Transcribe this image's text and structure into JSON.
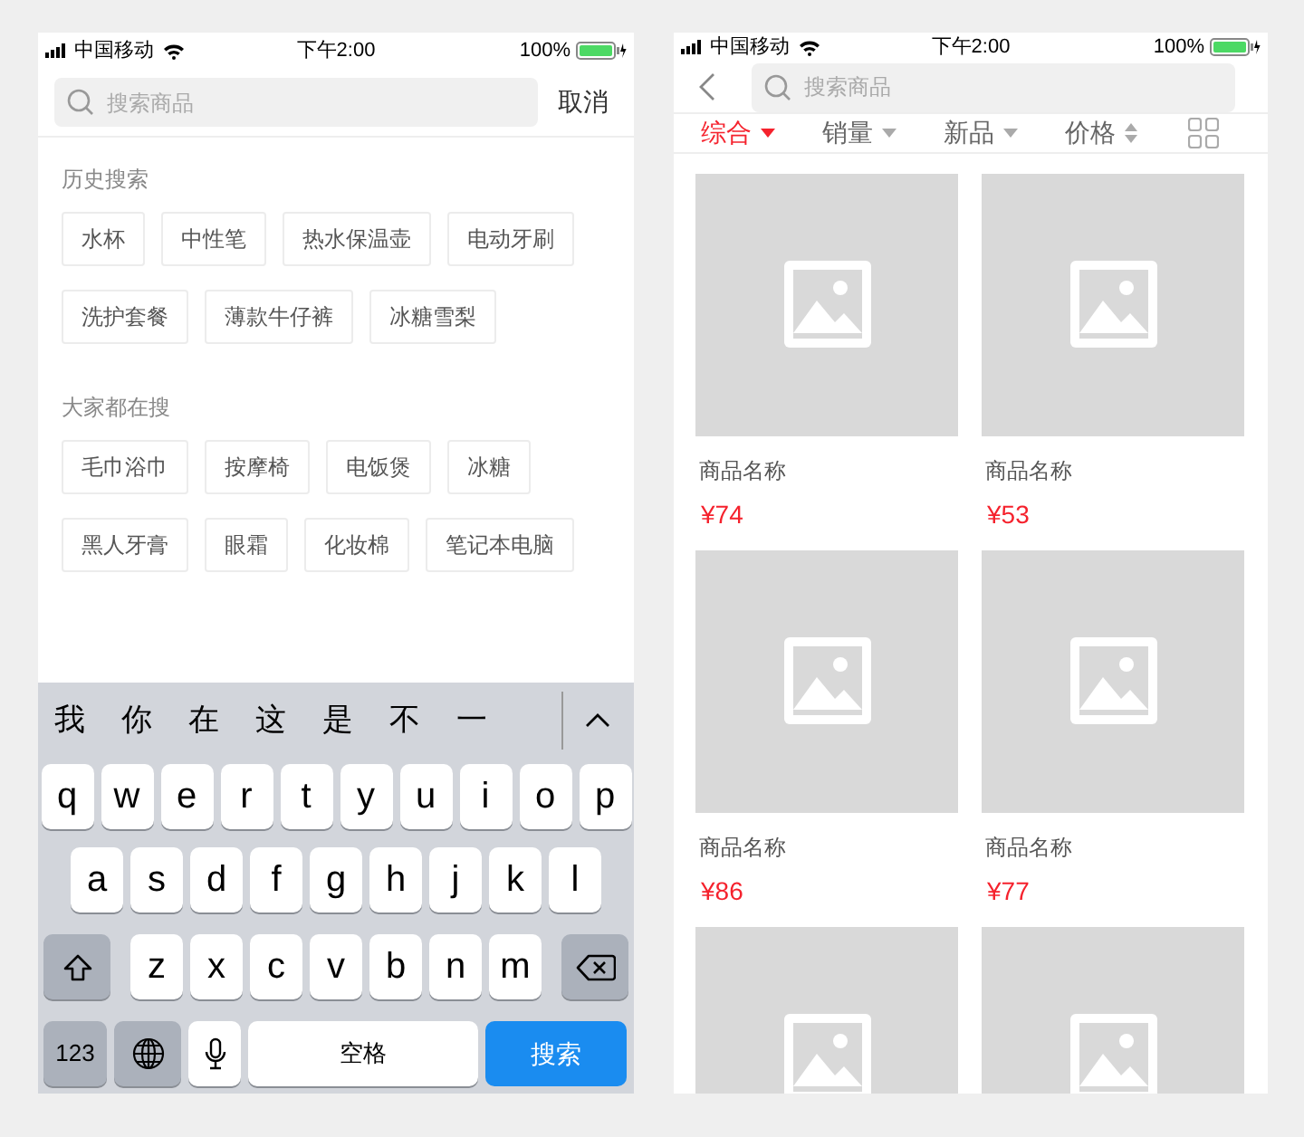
{
  "left_screen": {
    "status_bar": {
      "carrier": "中国移动",
      "time": "下午2:00",
      "battery": "100%"
    },
    "search": {
      "placeholder": "搜索商品"
    },
    "cancel": "取消",
    "history": {
      "title": "历史搜索",
      "tags": [
        "水杯",
        "中性笔",
        "热水保温壶",
        "电动牙刷",
        "洗护套餐",
        "薄款牛仔裤",
        "冰糖雪梨"
      ]
    },
    "popular": {
      "title": "大家都在搜",
      "tags": [
        "毛巾浴巾",
        "按摩椅",
        "电饭煲",
        "冰糖",
        "黑人牙膏",
        "眼霜",
        "化妆棉",
        "笔记本电脑"
      ]
    },
    "keyboard": {
      "candidates": [
        "我",
        "你",
        "在",
        "这",
        "是",
        "不",
        "一"
      ],
      "rows": [
        [
          "q",
          "w",
          "e",
          "r",
          "t",
          "y",
          "u",
          "i",
          "o",
          "p"
        ],
        [
          "a",
          "s",
          "d",
          "f",
          "g",
          "h",
          "j",
          "k",
          "l"
        ],
        [
          "z",
          "x",
          "c",
          "v",
          "b",
          "n",
          "m"
        ]
      ],
      "numbers_key": "123",
      "space_key": "空格",
      "search_key": "搜索"
    }
  },
  "right_screen": {
    "status_bar": {
      "carrier": "中国移动",
      "time": "下午2:00",
      "battery": "100%"
    },
    "search": {
      "placeholder": "搜索商品"
    },
    "sort_tabs": [
      {
        "label": "综合",
        "selected": true,
        "kind": "dropdown"
      },
      {
        "label": "销量",
        "selected": false,
        "kind": "dropdown"
      },
      {
        "label": "新品",
        "selected": false,
        "kind": "dropdown"
      },
      {
        "label": "价格",
        "selected": false,
        "kind": "order"
      }
    ],
    "products": [
      {
        "kind": "full",
        "name": "商品名称",
        "price": "¥74"
      },
      {
        "kind": "full",
        "name": "商品名称",
        "price": "¥53"
      },
      {
        "kind": "full",
        "name": "商品名称",
        "price": "¥86"
      },
      {
        "kind": "full",
        "name": "商品名称",
        "price": "¥77"
      },
      {
        "kind": "image-only"
      },
      {
        "kind": "image-only"
      }
    ]
  }
}
